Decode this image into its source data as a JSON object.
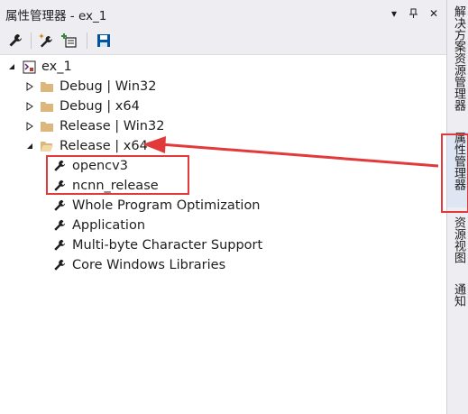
{
  "panel": {
    "title": "属性管理器 - ex_1",
    "dropdown_glyph": "▾",
    "pin_glyph": "ꟷ",
    "close_glyph": "✕"
  },
  "toolbar": {
    "items": [
      {
        "name": "properties-wrench-icon"
      },
      {
        "name": "add-new-property-sheet-icon"
      },
      {
        "name": "add-existing-property-sheet-icon"
      },
      {
        "name": "save-icon"
      }
    ]
  },
  "tree": {
    "root": {
      "label": "ex_1"
    },
    "configs": [
      {
        "label": "Debug | Win32",
        "expanded": false
      },
      {
        "label": "Debug | x64",
        "expanded": false
      },
      {
        "label": "Release | Win32",
        "expanded": false
      },
      {
        "label": "Release | x64",
        "expanded": true
      }
    ],
    "sheets": [
      {
        "label": "opencv3"
      },
      {
        "label": "ncnn_release"
      },
      {
        "label": "Whole Program Optimization"
      },
      {
        "label": "Application"
      },
      {
        "label": "Multi-byte Character Support"
      },
      {
        "label": "Core Windows Libraries"
      }
    ]
  },
  "sidebar": {
    "tabs": [
      {
        "label": "解决方案资源管理器",
        "active": false
      },
      {
        "label": "属性管理器",
        "active": true
      },
      {
        "label": "资源视图",
        "active": false
      },
      {
        "label": "通知",
        "active": false
      }
    ]
  },
  "colors": {
    "accent_red": "#e23a3a",
    "folder": "#dcb67a",
    "chrome": "#eeeef2"
  }
}
